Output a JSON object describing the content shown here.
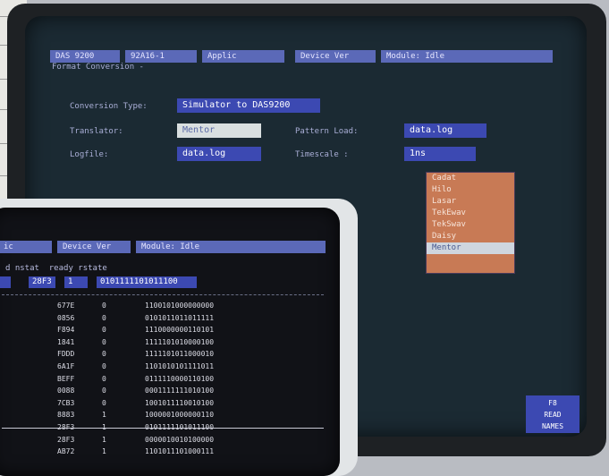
{
  "back_screen": {
    "header_bar": {
      "system": "DAS 9200",
      "card": "92A16-1",
      "applic": "Applic",
      "device_ver": "Device Ver",
      "module": "Module: Idle"
    },
    "section_title": "Format Conversion -",
    "conversion_type_label": "Conversion Type:",
    "conversion_type_value": "Simulator to DAS9200",
    "translator_label": "Translator:",
    "translator_value": "Mentor",
    "pattern_load_label": "Pattern Load:",
    "pattern_load_value": "data.log",
    "logfile_label": "Logfile:",
    "logfile_value": "data.log",
    "timescale_label": "Timescale :",
    "timescale_value": "1ns",
    "translator_options": [
      "Cadat",
      "Hilo",
      "Lasar",
      "TekEwav",
      "TekSwav",
      "Daisy",
      "Mentor"
    ],
    "translator_selected": "Mentor",
    "f8_key": "F8",
    "f8_line1": "READ",
    "f8_line2": "NAMES"
  },
  "front_screen": {
    "header_bar": {
      "applic_fragment": "ic",
      "device_ver": "Device Ver",
      "module": "Module: Idle"
    },
    "column_header": "d nstat  ready rstate",
    "current_row": {
      "nstat": "28F3",
      "ready": "1",
      "rstate": "0101111101011100"
    },
    "rows": [
      {
        "nstat": "677E",
        "ready": "0",
        "rstate": "1100101000000000"
      },
      {
        "nstat": "0856",
        "ready": "0",
        "rstate": "0101011011011111"
      },
      {
        "nstat": "F894",
        "ready": "0",
        "rstate": "1110000000110101"
      },
      {
        "nstat": "1841",
        "ready": "0",
        "rstate": "1111101010000100"
      },
      {
        "nstat": "FDDD",
        "ready": "0",
        "rstate": "1111101011000010"
      },
      {
        "nstat": "6A1F",
        "ready": "0",
        "rstate": "1101010101111011"
      },
      {
        "nstat": "BEFF",
        "ready": "0",
        "rstate": "0111110000110100"
      },
      {
        "nstat": "0088",
        "ready": "0",
        "rstate": "0001111111010100"
      },
      {
        "nstat": "7CB3",
        "ready": "0",
        "rstate": "1001011110010100"
      },
      {
        "nstat": "8883",
        "ready": "1",
        "rstate": "1000001000000110"
      },
      {
        "nstat": "28F3",
        "ready": "1",
        "rstate": "0101111101011100"
      },
      {
        "nstat": "28F3",
        "ready": "1",
        "rstate": "0000010010100000"
      },
      {
        "nstat": "AB72",
        "ready": "1",
        "rstate": "1101011101000111"
      }
    ]
  }
}
